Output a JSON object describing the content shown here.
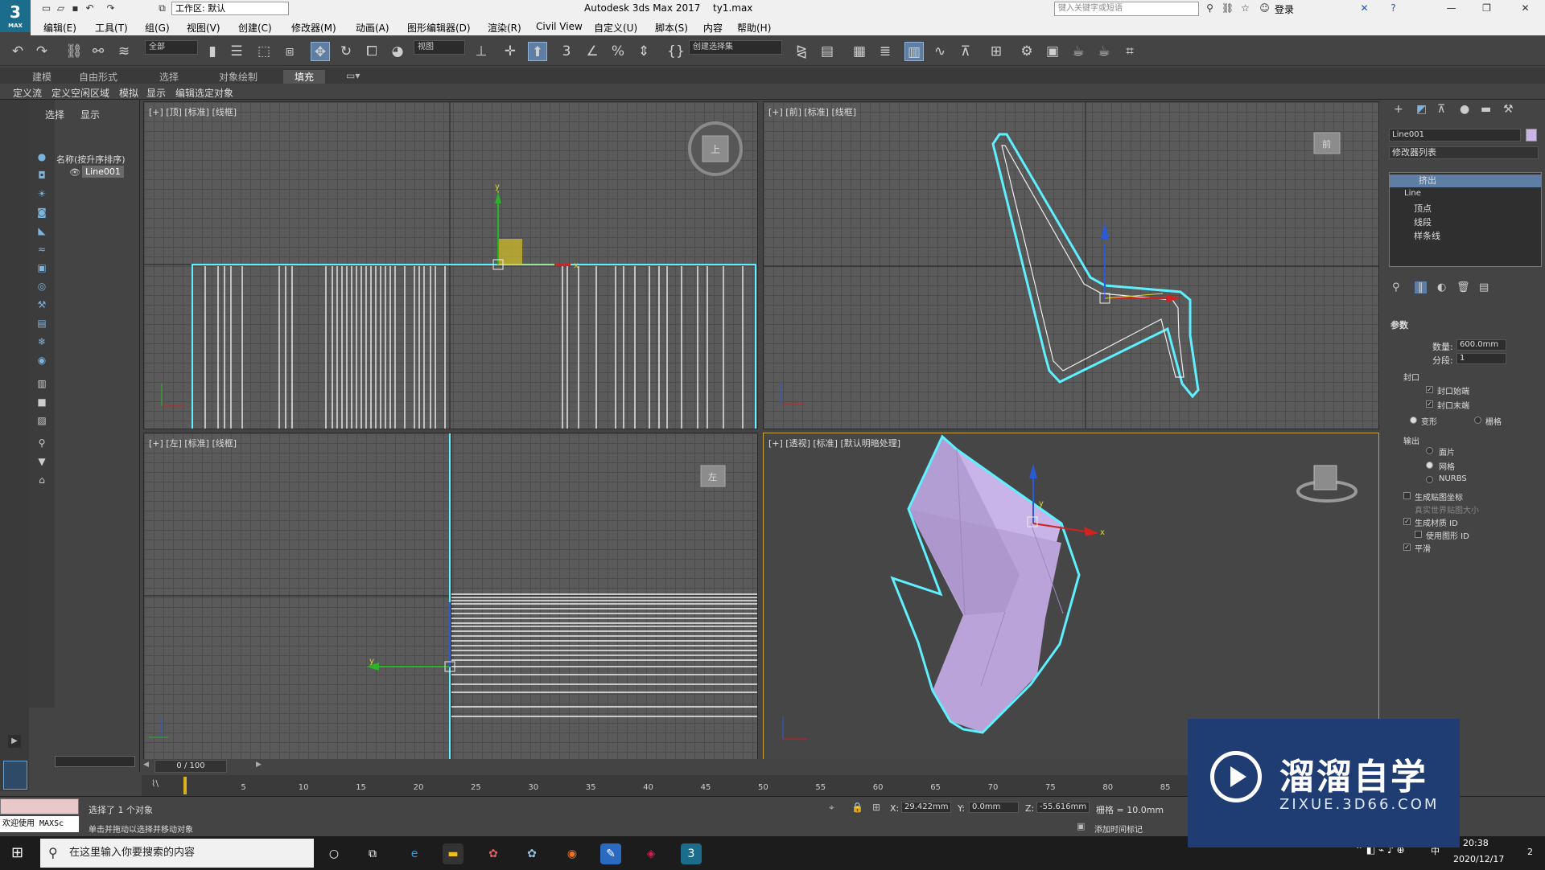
{
  "app": {
    "title": "Autodesk 3ds Max 2017",
    "file": "ty1.max",
    "logo_text": "3",
    "logo_sub": "MAX",
    "workspace": "工作区: 默认",
    "search_placeholder": "键入关键字或短语",
    "login": "登录"
  },
  "menu": [
    "编辑(E)",
    "工具(T)",
    "组(G)",
    "视图(V)",
    "创建(C)",
    "修改器(M)",
    "动画(A)",
    "图形编辑器(D)",
    "渲染(R)",
    "Civil View",
    "自定义(U)",
    "脚本(S)",
    "内容",
    "帮助(H)"
  ],
  "toolbar": {
    "filter": "全部",
    "refcoord": "视图",
    "selset": "创建选择集"
  },
  "ribbon": {
    "tabs": [
      "建模",
      "自由形式",
      "选择",
      "对象绘制",
      "填充"
    ],
    "active": "填充",
    "subtabs": [
      "定义流",
      "定义空闲区域",
      "模拟",
      "显示",
      "编辑选定对象"
    ]
  },
  "scene": {
    "tabs": [
      "选择",
      "显示"
    ],
    "column": "名称(按升序排序)",
    "object": "Line001"
  },
  "viewports": {
    "top": "[+] [顶] [标准] [线框]",
    "front": "[+] [前] [标准] [线框]",
    "left": "[+] [左] [标准] [线框]",
    "persp": "[+] [透视] [标准] [默认明暗处理]",
    "cube_top": "上",
    "cube_front": "前",
    "cube_left": "左"
  },
  "command_panel": {
    "object_name": "Line001",
    "object_color": "#c8b4e6",
    "modifier_list": "修改器列表",
    "stack": [
      "挤出",
      "Line",
      "顶点",
      "线段",
      "样条线"
    ],
    "params_title": "参数",
    "amount_label": "数量:",
    "amount": "600.0mm",
    "segments_label": "分段:",
    "segments": "1",
    "capping_title": "封口",
    "cap_start": "封口始端",
    "cap_end": "封口末端",
    "morph": "变形",
    "grid": "栅格",
    "output_title": "输出",
    "patch": "面片",
    "mesh": "网格",
    "nurbs": "NURBS",
    "gen_map": "生成贴图坐标",
    "real_world": "真实世界贴图大小",
    "gen_matid": "生成材质 ID",
    "use_shape_id": "使用图形 ID",
    "smooth": "平滑"
  },
  "timeline": {
    "frame": "0 / 100",
    "ticks": [
      "5",
      "10",
      "15",
      "20",
      "25",
      "30",
      "35",
      "40",
      "45",
      "50",
      "55",
      "60",
      "65",
      "70",
      "75",
      "80",
      "85"
    ]
  },
  "status": {
    "selected": "选择了 1 个对象",
    "hint": "单击并拖动以选择并移动对象",
    "welcome": "欢迎使用 MAXSc",
    "x_label": "X:",
    "x": "29.422mm",
    "y_label": "Y:",
    "y": "0.0mm",
    "z_label": "Z:",
    "z": "-55.616mm",
    "grid": "栅格 = 10.0mm",
    "add_tag": "添加时间标记"
  },
  "taskbar": {
    "search": "在这里输入你要搜索的内容",
    "time": "20:38",
    "date": "2020/12/17",
    "ime": "中",
    "notif": "2"
  },
  "watermark": {
    "title": "溜溜自学",
    "url": "ZIXUE.3D66.COM"
  },
  "colors": {
    "accent": "#5e7fa3",
    "selection": "#5ff0ff",
    "object": "#c8b4e6"
  }
}
